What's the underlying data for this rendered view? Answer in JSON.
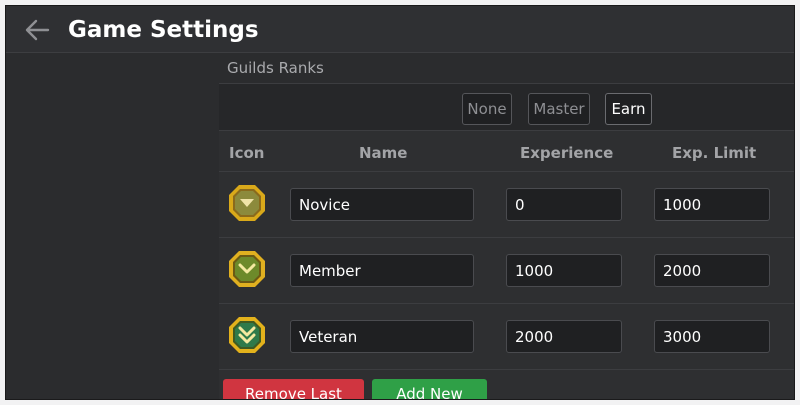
{
  "header": {
    "title": "Game Settings",
    "back_icon": "arrow-left-icon"
  },
  "section": {
    "label": "Guilds Ranks"
  },
  "filters": [
    {
      "label": "None",
      "active": false
    },
    {
      "label": "Master",
      "active": false
    },
    {
      "label": "Earn",
      "active": true
    }
  ],
  "columns": {
    "icon": "Icon",
    "name": "Name",
    "experience": "Experience",
    "limit": "Exp. Limit"
  },
  "ranks": [
    {
      "icon": "rank-novice-icon",
      "name": "Novice",
      "experience": "0",
      "limit": "1000"
    },
    {
      "icon": "rank-member-icon",
      "name": "Member",
      "experience": "1000",
      "limit": "2000"
    },
    {
      "icon": "rank-veteran-icon",
      "name": "Veteran",
      "experience": "2000",
      "limit": "3000"
    }
  ],
  "actions": {
    "remove": "Remove Last Rank",
    "add": "Add New Rank"
  },
  "colors": {
    "remove": "#d03540",
    "add": "#2fa047",
    "icon_gold": "#d9a91a"
  }
}
